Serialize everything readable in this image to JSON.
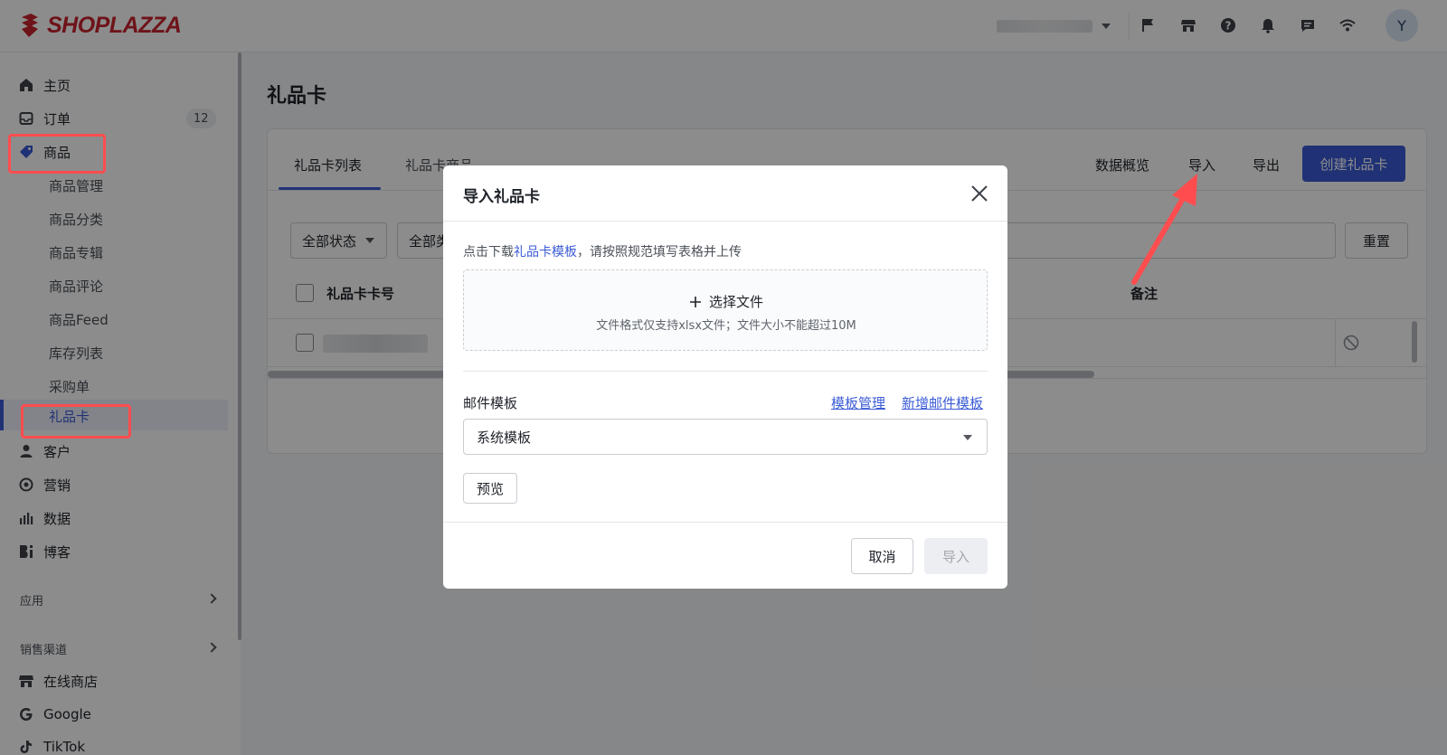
{
  "brand": {
    "logo_text": "SHOPLAZZA",
    "color": "#c8242e"
  },
  "topbar": {
    "icons": [
      "flag-icon",
      "store-icon",
      "help-icon",
      "bell-icon",
      "chat-icon",
      "wifi-icon"
    ],
    "avatar_initial": "Y"
  },
  "sidebar": {
    "items": [
      {
        "label": "主页",
        "icon": "home-icon"
      },
      {
        "label": "订单",
        "icon": "inbox-icon",
        "badge": "12"
      },
      {
        "label": "商品",
        "icon": "tag-icon"
      },
      {
        "label": "商品管理"
      },
      {
        "label": "商品分类"
      },
      {
        "label": "商品专辑"
      },
      {
        "label": "商品评论"
      },
      {
        "label": "商品Feed"
      },
      {
        "label": "库存列表"
      },
      {
        "label": "采购单"
      },
      {
        "label": "礼品卡"
      },
      {
        "label": "客户",
        "icon": "person-icon"
      },
      {
        "label": "营销",
        "icon": "target-icon"
      },
      {
        "label": "数据",
        "icon": "bar-chart-icon"
      },
      {
        "label": "博客",
        "icon": "blog-icon"
      }
    ],
    "apps_label": "应用",
    "channels_label": "销售渠道",
    "channels": [
      {
        "label": "在线商店",
        "icon": "store-icon"
      },
      {
        "label": "Google",
        "icon": "google-icon"
      },
      {
        "label": "TikTok",
        "icon": "tiktok-icon"
      }
    ]
  },
  "main": {
    "page_title": "礼品卡",
    "tabs": [
      {
        "label": "礼品卡列表"
      },
      {
        "label": "礼品卡商品"
      }
    ],
    "actions": {
      "overview": "数据概览",
      "import": "导入",
      "export": "导出",
      "create": "创建礼品卡"
    },
    "filters": {
      "status": "全部状态",
      "second": "全部类",
      "reset": "重置"
    },
    "table": {
      "col_card_no": "礼品卡卡号",
      "col_note": "备注"
    }
  },
  "modal": {
    "title": "导入礼品卡",
    "hint_prefix": "点击下载",
    "hint_link": "礼品卡模板",
    "hint_suffix": "，请按照规范填写表格并上传",
    "dropzone_main": "选择文件",
    "dropzone_sub": "文件格式仅支持xlsx文件；文件大小不能超过10M",
    "email_label": "邮件模板",
    "link_manage": "模板管理",
    "link_new": "新增邮件模板",
    "select_value": "系统模板",
    "preview": "预览",
    "cancel": "取消",
    "import": "导入"
  },
  "colors": {
    "accent": "#3b5bd6",
    "annotation": "#ff4d4f"
  }
}
